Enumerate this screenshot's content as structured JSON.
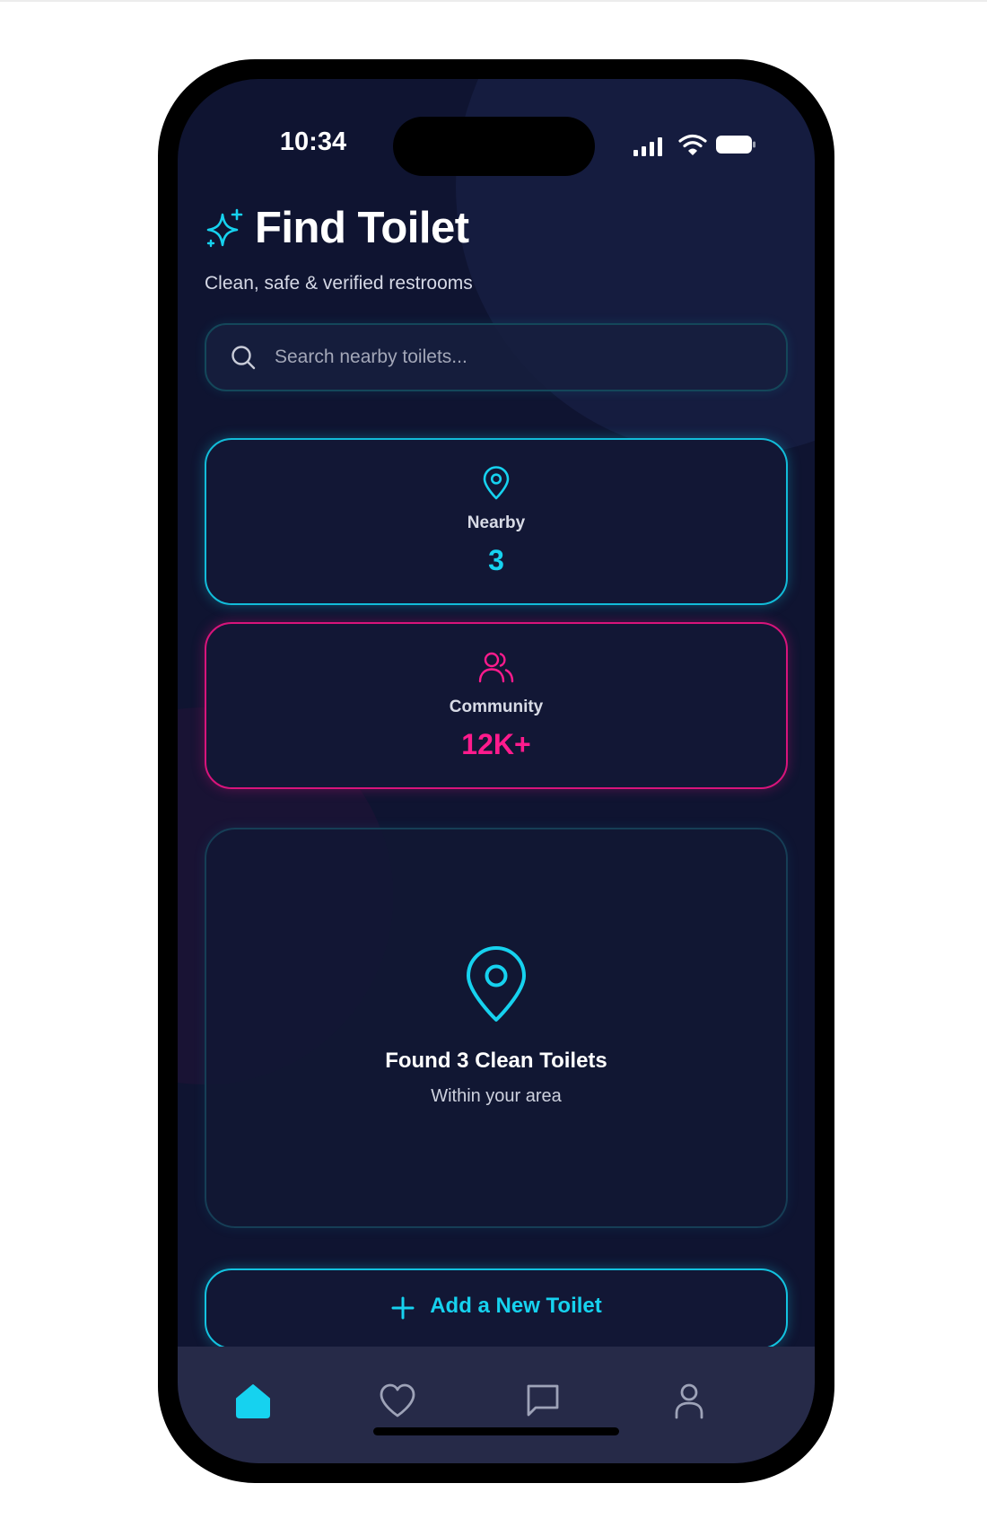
{
  "status_bar": {
    "time": "10:34"
  },
  "header": {
    "title": "Find Toilet",
    "subtitle": "Clean, safe & verified restrooms",
    "icon": "sparkle-icon"
  },
  "search": {
    "placeholder": "Search nearby toilets..."
  },
  "stats": {
    "nearby": {
      "label": "Nearby",
      "value": "3",
      "icon": "map-pin-icon",
      "color": "#16d2ef"
    },
    "community": {
      "label": "Community",
      "value": "12K+",
      "icon": "users-icon",
      "color": "#ff1b8d"
    }
  },
  "result": {
    "title": "Found 3 Clean Toilets",
    "subtitle": "Within your area",
    "icon": "map-pin-icon"
  },
  "add_button": {
    "label": "Add a New Toilet",
    "icon": "plus-icon"
  },
  "tabbar": {
    "items": [
      {
        "name": "home",
        "icon": "home-icon",
        "active": true
      },
      {
        "name": "favorites",
        "icon": "heart-icon",
        "active": false
      },
      {
        "name": "messages",
        "icon": "chat-icon",
        "active": false
      },
      {
        "name": "profile",
        "icon": "user-icon",
        "active": false
      }
    ]
  },
  "colors": {
    "accent_cyan": "#16d2ef",
    "accent_pink": "#ff1b8d",
    "background": "#0f1431",
    "tabbar": "#262a48"
  }
}
